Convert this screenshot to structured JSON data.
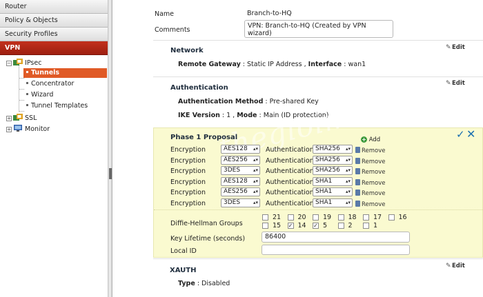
{
  "sidebar": {
    "sections": [
      "Router",
      "Policy & Objects",
      "Security Profiles",
      "VPN"
    ],
    "tree": {
      "ipsec": "IPsec",
      "tunnels": "Tunnels",
      "concentrator": "Concentrator",
      "wizard": "Wizard",
      "tunnel_templates": "Tunnel Templates",
      "ssl": "SSL",
      "monitor": "Monitor"
    }
  },
  "form": {
    "name_label": "Name",
    "name_value": "Branch-to-HQ",
    "comments_label": "Comments",
    "comments_value": "VPN: Branch-to-HQ (Created by VPN wizard)"
  },
  "network": {
    "title": "Network",
    "edit": "Edit",
    "gateway_label": "Remote Gateway",
    "gateway_value": "Static IP Address",
    "interface_label": "Interface",
    "interface_value": "wan1"
  },
  "authentication": {
    "title": "Authentication",
    "edit": "Edit",
    "method_label": "Authentication Method",
    "method_value": "Pre-shared Key",
    "ike_label": "IKE Version",
    "ike_value": "1",
    "mode_label": "Mode",
    "mode_value": "Main (ID protection)"
  },
  "phase1": {
    "title": "Phase 1 Proposal",
    "add": "Add",
    "encryption_label": "Encryption",
    "authentication_label": "Authentication",
    "remove": "Remove",
    "proposals": [
      {
        "enc": "AES128",
        "auth": "SHA256"
      },
      {
        "enc": "AES256",
        "auth": "SHA256"
      },
      {
        "enc": "3DES",
        "auth": "SHA256"
      },
      {
        "enc": "AES128",
        "auth": "SHA1"
      },
      {
        "enc": "AES256",
        "auth": "SHA1"
      },
      {
        "enc": "3DES",
        "auth": "SHA1"
      }
    ],
    "dh_label": "Diffie-Hellman Groups",
    "dh_groups": [
      {
        "n": "21",
        "checked": false
      },
      {
        "n": "20",
        "checked": false
      },
      {
        "n": "19",
        "checked": false
      },
      {
        "n": "18",
        "checked": false
      },
      {
        "n": "17",
        "checked": false
      },
      {
        "n": "16",
        "checked": false
      },
      {
        "n": "15",
        "checked": false
      },
      {
        "n": "14",
        "checked": true
      },
      {
        "n": "5",
        "checked": true
      },
      {
        "n": "2",
        "checked": false
      },
      {
        "n": "1",
        "checked": false
      }
    ],
    "key_lifetime_label": "Key Lifetime (seconds)",
    "key_lifetime_value": "86400",
    "local_id_label": "Local ID",
    "local_id_value": ""
  },
  "xauth": {
    "title": "XAUTH",
    "edit": "Edit",
    "type_label": "Type",
    "type_value": "Disabled"
  },
  "watermark": "thegioimang.vn",
  "colors": {
    "accent_red": "#b1281a",
    "selected": "#e05a26",
    "phase_bg": "#fafad0",
    "confirm": "#1a6fb0"
  }
}
